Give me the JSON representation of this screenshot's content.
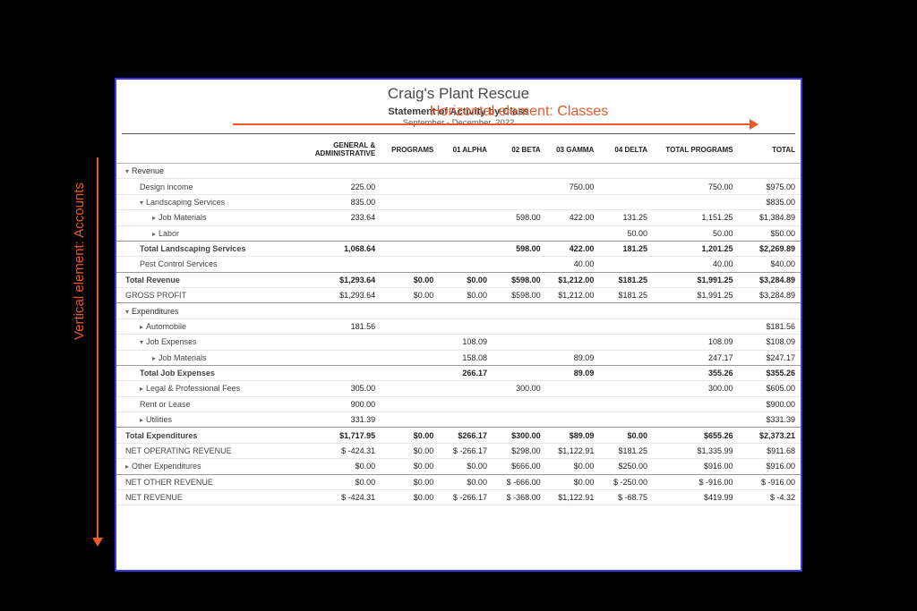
{
  "report": {
    "company": "Craig's Plant Rescue",
    "title": "Statement of Activity by Class",
    "period": "September - December, 2022"
  },
  "annotations": {
    "horizontal": "Horizontal element: Classes",
    "vertical": "Vertical element: Accounts"
  },
  "columns": {
    "acct": "",
    "ga": "GENERAL & ADMINISTRATIVE",
    "programs": "PROGRAMS",
    "c1": "01 ALPHA",
    "c2": "02 BETA",
    "c3": "03 GAMMA",
    "c4": "04 DELTA",
    "totprog": "TOTAL PROGRAMS",
    "total": "TOTAL"
  },
  "rows": [
    {
      "label": "Revenue",
      "type": "section",
      "caret": "down",
      "indent": 0,
      "cells": [
        "",
        "",
        "",
        "",
        "",
        "",
        "",
        ""
      ]
    },
    {
      "label": "Design income",
      "indent": 1,
      "cells": [
        "225.00",
        "",
        "",
        "",
        "750.00",
        "",
        "750.00",
        "$975.00"
      ]
    },
    {
      "label": "Landscaping Services",
      "caret": "down",
      "indent": 1,
      "cells": [
        "835.00",
        "",
        "",
        "",
        "",
        "",
        "",
        "$835.00"
      ]
    },
    {
      "label": "Job Materials",
      "caret": "right",
      "indent": 2,
      "cells": [
        "233.64",
        "",
        "",
        "598.00",
        "422.00",
        "131.25",
        "1,151.25",
        "$1,384.89"
      ]
    },
    {
      "label": "Labor",
      "caret": "right",
      "indent": 2,
      "sep": true,
      "cells": [
        "",
        "",
        "",
        "",
        "",
        "50.00",
        "50.00",
        "$50.00"
      ]
    },
    {
      "label": "Total Landscaping Services",
      "bold": true,
      "indent": 1,
      "cells": [
        "1,068.64",
        "",
        "",
        "598.00",
        "422.00",
        "181.25",
        "1,201.25",
        "$2,269.89"
      ]
    },
    {
      "label": "Pest Control Services",
      "indent": 1,
      "sep": true,
      "cells": [
        "",
        "",
        "",
        "",
        "40.00",
        "",
        "40.00",
        "$40.00"
      ]
    },
    {
      "label": "Total Revenue",
      "bold": true,
      "indent": 0,
      "cells": [
        "$1,293.64",
        "$0.00",
        "$0.00",
        "$598.00",
        "$1,212.00",
        "$181.25",
        "$1,991.25",
        "$3,284.89"
      ]
    },
    {
      "label": "GROSS PROFIT",
      "indent": 0,
      "sep": true,
      "cells": [
        "$1,293.64",
        "$0.00",
        "$0.00",
        "$598.00",
        "$1,212.00",
        "$181.25",
        "$1,991.25",
        "$3,284.89"
      ]
    },
    {
      "label": "Expenditures",
      "type": "section",
      "caret": "down",
      "indent": 0,
      "cells": [
        "",
        "",
        "",
        "",
        "",
        "",
        "",
        ""
      ]
    },
    {
      "label": "Automobile",
      "caret": "right",
      "indent": 1,
      "cells": [
        "181.56",
        "",
        "",
        "",
        "",
        "",
        "",
        "$181.56"
      ]
    },
    {
      "label": "Job Expenses",
      "caret": "down",
      "indent": 1,
      "cells": [
        "",
        "",
        "108.09",
        "",
        "",
        "",
        "108.09",
        "$108.09"
      ]
    },
    {
      "label": "Job Materials",
      "caret": "right",
      "indent": 2,
      "sep": true,
      "cells": [
        "",
        "",
        "158.08",
        "",
        "89.09",
        "",
        "247.17",
        "$247.17"
      ]
    },
    {
      "label": "Total Job Expenses",
      "bold": true,
      "indent": 1,
      "cells": [
        "",
        "",
        "266.17",
        "",
        "89.09",
        "",
        "355.26",
        "$355.26"
      ]
    },
    {
      "label": "Legal & Professional Fees",
      "caret": "right",
      "indent": 1,
      "cells": [
        "305.00",
        "",
        "",
        "300.00",
        "",
        "",
        "300.00",
        "$605.00"
      ]
    },
    {
      "label": "Rent or Lease",
      "indent": 1,
      "cells": [
        "900.00",
        "",
        "",
        "",
        "",
        "",
        "",
        "$900.00"
      ]
    },
    {
      "label": "Utilities",
      "caret": "right",
      "indent": 1,
      "sep": true,
      "cells": [
        "331.39",
        "",
        "",
        "",
        "",
        "",
        "",
        "$331.39"
      ]
    },
    {
      "label": "Total Expenditures",
      "bold": true,
      "indent": 0,
      "cells": [
        "$1,717.95",
        "$0.00",
        "$266.17",
        "$300.00",
        "$89.09",
        "$0.00",
        "$655.26",
        "$2,373.21"
      ]
    },
    {
      "label": "NET OPERATING REVENUE",
      "indent": 0,
      "cells": [
        "$ -424.31",
        "$0.00",
        "$ -266.17",
        "$298.00",
        "$1,122.91",
        "$181.25",
        "$1,335.99",
        "$911.68"
      ]
    },
    {
      "label": "Other Expenditures",
      "caret": "right",
      "indent": 0,
      "sep": true,
      "cells": [
        "$0.00",
        "$0.00",
        "$0.00",
        "$666.00",
        "$0.00",
        "$250.00",
        "$916.00",
        "$916.00"
      ]
    },
    {
      "label": "NET OTHER REVENUE",
      "indent": 0,
      "cells": [
        "$0.00",
        "$0.00",
        "$0.00",
        "$ -666.00",
        "$0.00",
        "$ -250.00",
        "$ -916.00",
        "$ -916.00"
      ]
    },
    {
      "label": "NET REVENUE",
      "indent": 0,
      "cells": [
        "$ -424.31",
        "$0.00",
        "$ -266.17",
        "$ -368.00",
        "$1,122.91",
        "$ -68.75",
        "$419.99",
        "$ -4.32"
      ]
    }
  ]
}
